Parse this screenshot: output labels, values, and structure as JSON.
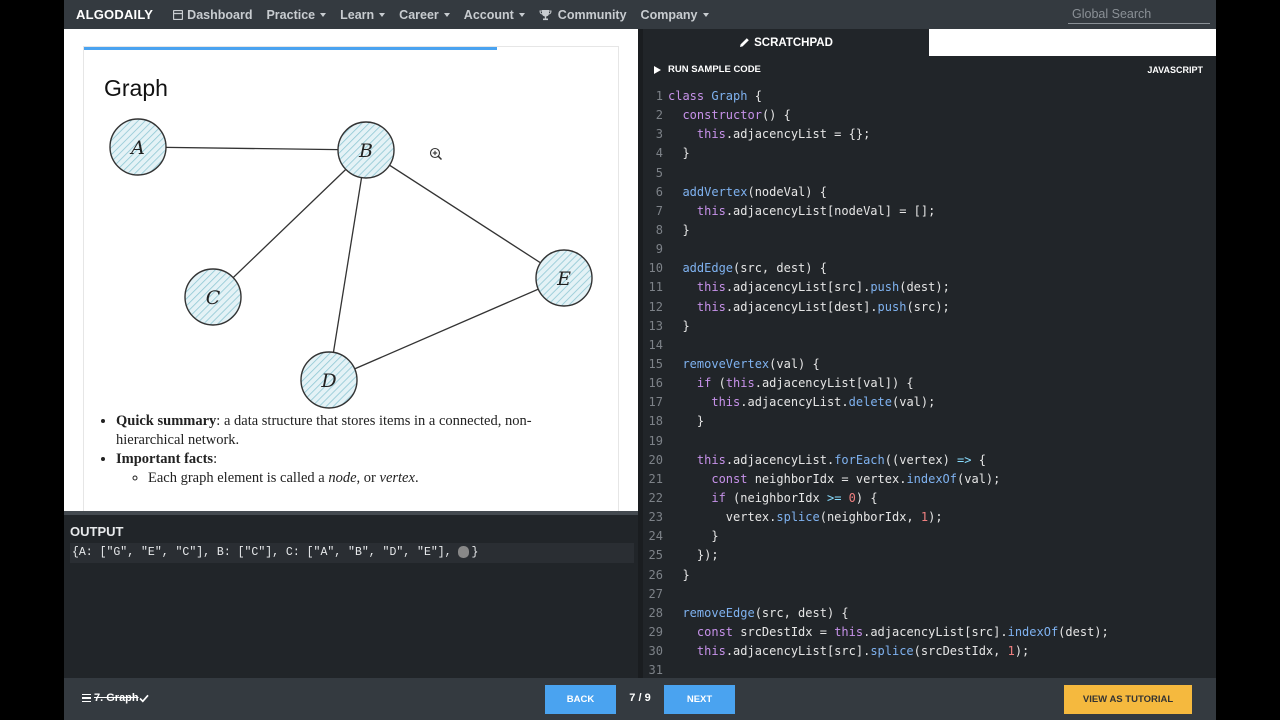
{
  "nav": {
    "brand": "ALGODAILY",
    "items": [
      {
        "label": "Dashboard",
        "icon": "dashboard-icon",
        "dropdown": false
      },
      {
        "label": "Practice",
        "dropdown": true
      },
      {
        "label": "Learn",
        "dropdown": true
      },
      {
        "label": "Career",
        "dropdown": true
      },
      {
        "label": "Account",
        "dropdown": true
      },
      {
        "label": "Community",
        "icon": "trophy-icon",
        "dropdown": false
      },
      {
        "label": "Company",
        "dropdown": true
      }
    ],
    "search_placeholder": "Global Search"
  },
  "lesson": {
    "title": "Graph",
    "graph_nodes": [
      "A",
      "B",
      "C",
      "D",
      "E"
    ],
    "graph_edges": [
      [
        "A",
        "B"
      ],
      [
        "B",
        "C"
      ],
      [
        "B",
        "D"
      ],
      [
        "B",
        "E"
      ],
      [
        "D",
        "E"
      ]
    ],
    "summary": {
      "item1_bold": "Quick summary",
      "item1_text": ": a data structure that stores items in a connected, non-hierarchical network.",
      "item2_bold": "Important facts",
      "item2_text": ":",
      "sub1_pre": "Each graph element is called a ",
      "sub1_em1": "node",
      "sub1_mid": ", or ",
      "sub1_em2": "vertex",
      "sub1_post": "."
    }
  },
  "output": {
    "title": "OUTPUT",
    "line": "{A: [\"G\", \"E\", \"C\"], B: [\"C\"], C: [\"A\", \"B\", \"D\", \"E\"], ",
    "line_end": "}"
  },
  "scratchpad": {
    "tab_label": "SCRATCHPAD",
    "run_label": "RUN SAMPLE CODE",
    "language": "JAVASCRIPT",
    "lines": [
      "class Graph {",
      "  constructor() {",
      "    this.adjacencyList = {};",
      "  }",
      "",
      "  addVertex(nodeVal) {",
      "    this.adjacencyList[nodeVal] = [];",
      "  }",
      "",
      "  addEdge(src, dest) {",
      "    this.adjacencyList[src].push(dest);",
      "    this.adjacencyList[dest].push(src);",
      "  }",
      "",
      "  removeVertex(val) {",
      "    if (this.adjacencyList[val]) {",
      "      this.adjacencyList.delete(val);",
      "    }",
      "",
      "    this.adjacencyList.forEach((vertex) => {",
      "      const neighborIdx = vertex.indexOf(val);",
      "      if (neighborIdx >= 0) {",
      "        vertex.splice(neighborIdx, 1);",
      "      }",
      "    });",
      "  }",
      "",
      "  removeEdge(src, dest) {",
      "    const srcDestIdx = this.adjacencyList[src].indexOf(dest);",
      "    this.adjacencyList[src].splice(srcDestIdx, 1);",
      ""
    ]
  },
  "footer": {
    "lesson_name": "7. Graph",
    "back_label": "BACK",
    "pager": "7 / 9",
    "next_label": "NEXT",
    "tutorial_label": "VIEW AS TUTORIAL"
  },
  "colors": {
    "accent_blue": "#4aa3f0",
    "tutorial_yellow": "#f5b93e",
    "node_fill": "#cfe8ef"
  }
}
